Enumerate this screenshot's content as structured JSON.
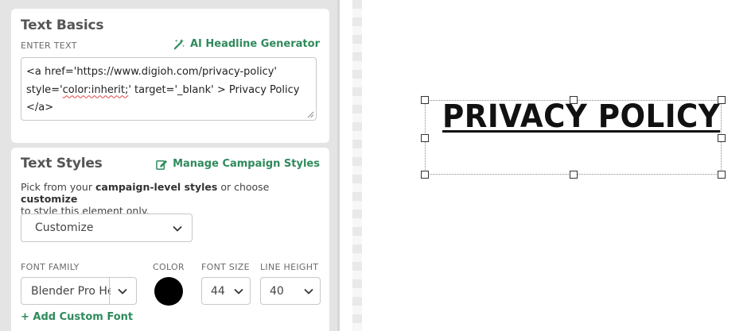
{
  "text_basics": {
    "title": "Text Basics",
    "enter_text_label": "ENTER TEXT",
    "ai_link": "AI Headline Generator",
    "ai_icon": "magic-wand-icon",
    "textarea_lines": [
      "<a href='https://www.digioh.com/privacy-policy'",
      "target='_blank' > Privacy Policy",
      "</a>"
    ],
    "textarea_line2_prefix": "style='",
    "textarea_line2_squiggle": "color:inherit;",
    "textarea_line2_suffix": "' target='_blank' > Privacy Policy"
  },
  "text_styles": {
    "title": "Text Styles",
    "manage_link": "Manage Campaign Styles",
    "manage_icon": "edit-icon",
    "desc_pre": "Pick from your ",
    "desc_bold1": "campaign-level styles",
    "desc_mid": " or choose ",
    "desc_bold2": "customize",
    "desc_post": "to style this element only.",
    "style_select": "Customize",
    "labels": {
      "font_family": "FONT FAMILY",
      "color": "COLOR",
      "font_size": "FONT SIZE",
      "line_height": "LINE HEIGHT"
    },
    "font_family_value": "Blender Pro Heavy",
    "color_value": "#000000",
    "font_size_value": "44",
    "line_height_value": "40",
    "add_font": "+ Add Custom Font"
  },
  "canvas": {
    "element_text": "PRIVACY POLICY"
  }
}
